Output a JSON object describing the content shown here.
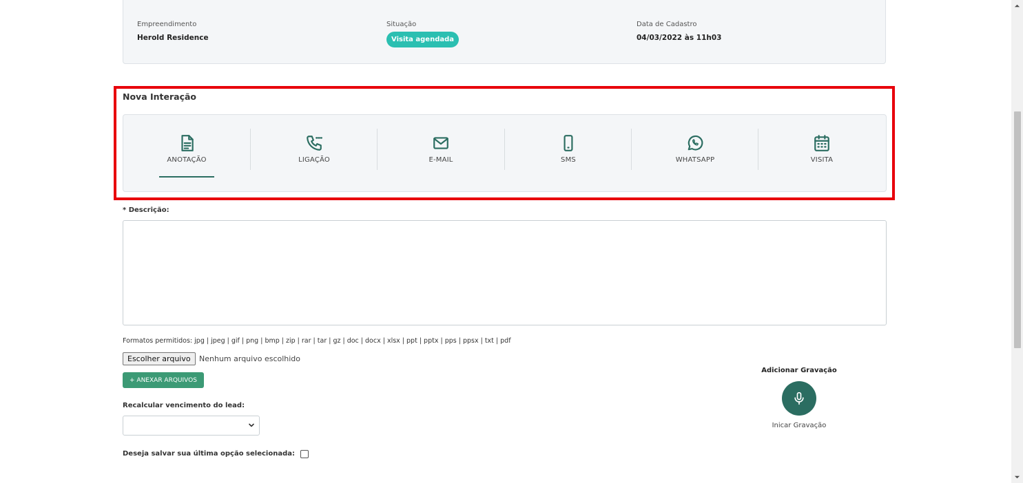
{
  "info": {
    "empreendimento_label": "Empreendimento",
    "empreendimento_value": "Herold Residence",
    "situacao_label": "Situação",
    "situacao_value": "Visita agendada",
    "data_label": "Data de Cadastro",
    "data_value": "04/03/2022 às 11h03"
  },
  "nova_interacao": {
    "title": "Nova Interação",
    "types": [
      {
        "label": "ANOTAÇÃO",
        "icon": "document-icon",
        "active": true
      },
      {
        "label": "LIGAÇÃO",
        "icon": "phone-icon",
        "active": false
      },
      {
        "label": "E-MAIL",
        "icon": "envelope-icon",
        "active": false
      },
      {
        "label": "SMS",
        "icon": "mobile-icon",
        "active": false
      },
      {
        "label": "WHATSAPP",
        "icon": "whatsapp-icon",
        "active": false
      },
      {
        "label": "VISITA",
        "icon": "calendar-icon",
        "active": false
      }
    ]
  },
  "form": {
    "descricao_label": "* Descrição:",
    "descricao_value": "",
    "formatos": "Formatos permitidos: jpg | jpeg | gif | png | bmp | zip | rar | tar | gz | doc | docx | xlsx | ppt | pptx | pps | ppsx | txt | pdf",
    "file_button": "Escolher arquivo",
    "file_status": "Nenhum arquivo escolhido",
    "attach_button": "+ ANEXAR ARQUIVOS",
    "recalc_label": "Recalcular vencimento do lead:",
    "recalc_value": "",
    "save_label": "Deseja salvar sua última opção selecionada:",
    "save_checked": false
  },
  "recording": {
    "title": "Adicionar Gravação",
    "caption": "Inicar Gravação",
    "icon": "microphone-icon"
  },
  "colors": {
    "accent": "#2b6d61",
    "badge": "#2bbfb1",
    "attach": "#3c9a75",
    "highlight": "#e8000b"
  }
}
